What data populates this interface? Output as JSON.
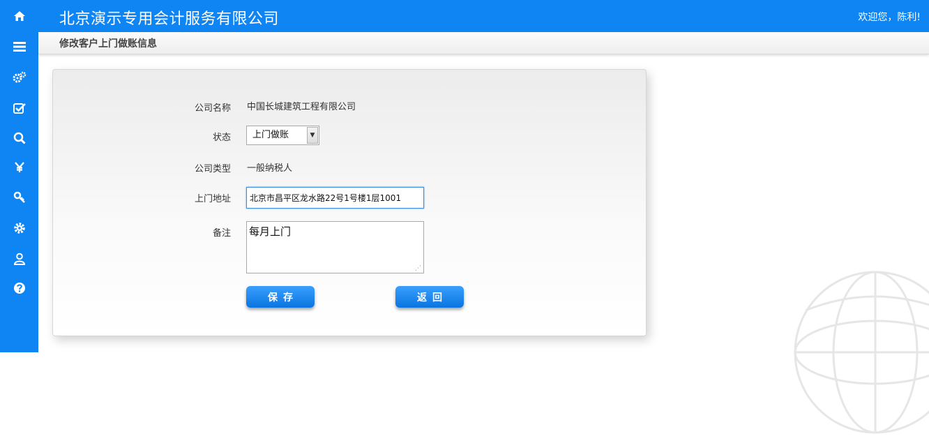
{
  "sidebar": {
    "icons": [
      {
        "name": "home-icon",
        "glyph": "⌂"
      },
      {
        "name": "list-icon",
        "glyph": "☰"
      },
      {
        "name": "gears-icon",
        "glyph": "⚙"
      },
      {
        "name": "checkbox-icon",
        "glyph": "☑"
      },
      {
        "name": "search-icon",
        "glyph": "⌕"
      },
      {
        "name": "yen-icon",
        "glyph": "¥"
      },
      {
        "name": "key-icon",
        "glyph": "⚷"
      },
      {
        "name": "cog-icon",
        "glyph": "✱"
      },
      {
        "name": "user-icon",
        "glyph": "♙"
      },
      {
        "name": "help-icon",
        "glyph": "?"
      }
    ],
    "color": "#0f85f4"
  },
  "header": {
    "title": "北京演示专用会计服务有限公司",
    "welcome": "欢迎您，陈利!"
  },
  "page": {
    "title": "修改客户上门做账信息"
  },
  "form": {
    "company_name_label": "公司名称",
    "company_name": "中国长城建筑工程有限公司",
    "status_label": "状态",
    "status_value": "上门做账",
    "company_type_label": "公司类型",
    "company_type": "一般纳税人",
    "address_label": "上门地址",
    "address_value": "北京市昌平区龙水路22号1号楼1层1001",
    "remark_label": "备注",
    "remark_value": "每月上门"
  },
  "buttons": {
    "save": "保存",
    "back": "返回"
  },
  "colors": {
    "accent": "#0f85f4",
    "button": "#1a86f0"
  }
}
